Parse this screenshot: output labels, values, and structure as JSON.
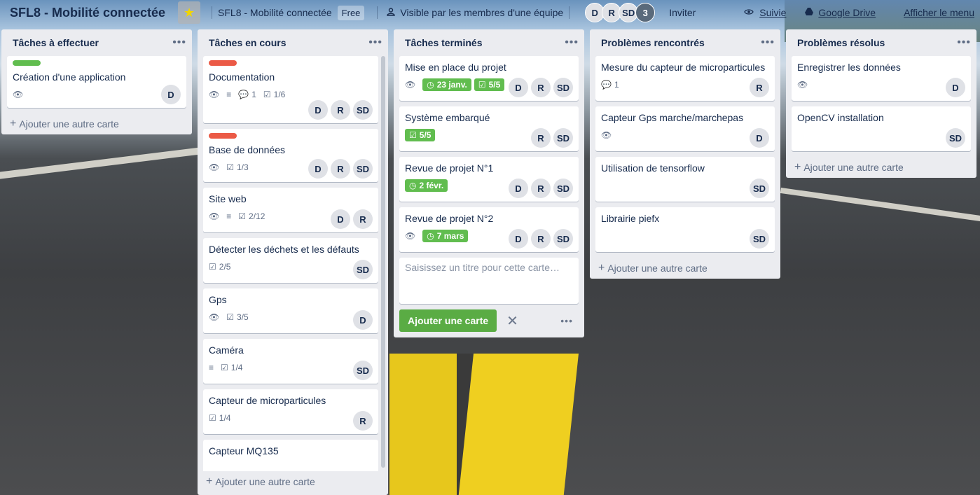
{
  "header": {
    "board_title": "SFL8 - Mobilité connectée",
    "team_name": "SFL8 - Mobilité connectée",
    "plan": "Free",
    "visibility": "Visible par les membres d'une équipe",
    "members": [
      "D",
      "R",
      "SD"
    ],
    "member_overflow": "3",
    "invite": "Inviter",
    "follow": "Suivie",
    "drive": "Google Drive",
    "more": "Afficher le menu"
  },
  "colors": {
    "green": "#61bd4f",
    "red": "#eb5a46",
    "list_bg": "#ebecf0"
  },
  "lists": [
    {
      "title": "Tâches à effectuer",
      "add_label": "Ajouter une autre carte",
      "cards": [
        {
          "title": "Création d'une application",
          "label": "green",
          "members": [
            "D"
          ]
        }
      ]
    },
    {
      "title": "Tâches en cours",
      "add_label": "Ajouter une autre carte",
      "cards": [
        {
          "title": "Documentation",
          "label": "red",
          "comments": "1",
          "checklist": "1/6",
          "members": [
            "D",
            "R",
            "SD"
          ]
        },
        {
          "title": "Base de données",
          "label": "red",
          "checklist": "1/3",
          "members": [
            "D",
            "R",
            "SD"
          ]
        },
        {
          "title": "Site web",
          "checklist": "2/12",
          "members": [
            "D",
            "R"
          ]
        },
        {
          "title": "Détecter les déchets et les défauts",
          "checklist": "2/5",
          "members": [
            "SD"
          ]
        },
        {
          "title": "Gps",
          "checklist": "3/5",
          "members": [
            "D"
          ]
        },
        {
          "title": "Caméra",
          "checklist": "1/4",
          "members": [
            "SD"
          ]
        },
        {
          "title": "Capteur de microparticules",
          "checklist": "1/4",
          "members": [
            "R"
          ]
        },
        {
          "title": "Capteur MQ135"
        }
      ]
    },
    {
      "title": "Tâches terminés",
      "cards": [
        {
          "title": "Mise en place du projet",
          "due": "23 janv.",
          "checklist": "5/5",
          "members": [
            "D",
            "R",
            "SD"
          ]
        },
        {
          "title": "Système embarqué",
          "checklist": "5/5",
          "members": [
            "R",
            "SD"
          ]
        },
        {
          "title": "Revue de projet N°1",
          "due": "2 févr.",
          "members": [
            "D",
            "R",
            "SD"
          ]
        },
        {
          "title": "Revue de projet N°2",
          "due": "7 mars",
          "members": [
            "D",
            "R",
            "SD"
          ]
        }
      ],
      "composer_placeholder": "Saisissez un titre pour cette carte…",
      "composer_add": "Ajouter une carte"
    },
    {
      "title": "Problèmes rencontrés",
      "add_label": "Ajouter une autre carte",
      "cards": [
        {
          "title": "Mesure du capteur de microparticules",
          "comments": "1",
          "members": [
            "R"
          ]
        },
        {
          "title": "Capteur Gps marche/marchepas",
          "members": [
            "D"
          ]
        },
        {
          "title": "Utilisation de tensorflow",
          "members": [
            "SD"
          ]
        },
        {
          "title": "Librairie piefx",
          "members": [
            "SD"
          ]
        }
      ]
    },
    {
      "title": "Problèmes résolus",
      "add_label": "Ajouter une autre carte",
      "cards": [
        {
          "title": "Enregistrer les données",
          "members": [
            "D"
          ]
        },
        {
          "title": "OpenCV installation",
          "members": [
            "SD"
          ]
        }
      ]
    }
  ]
}
